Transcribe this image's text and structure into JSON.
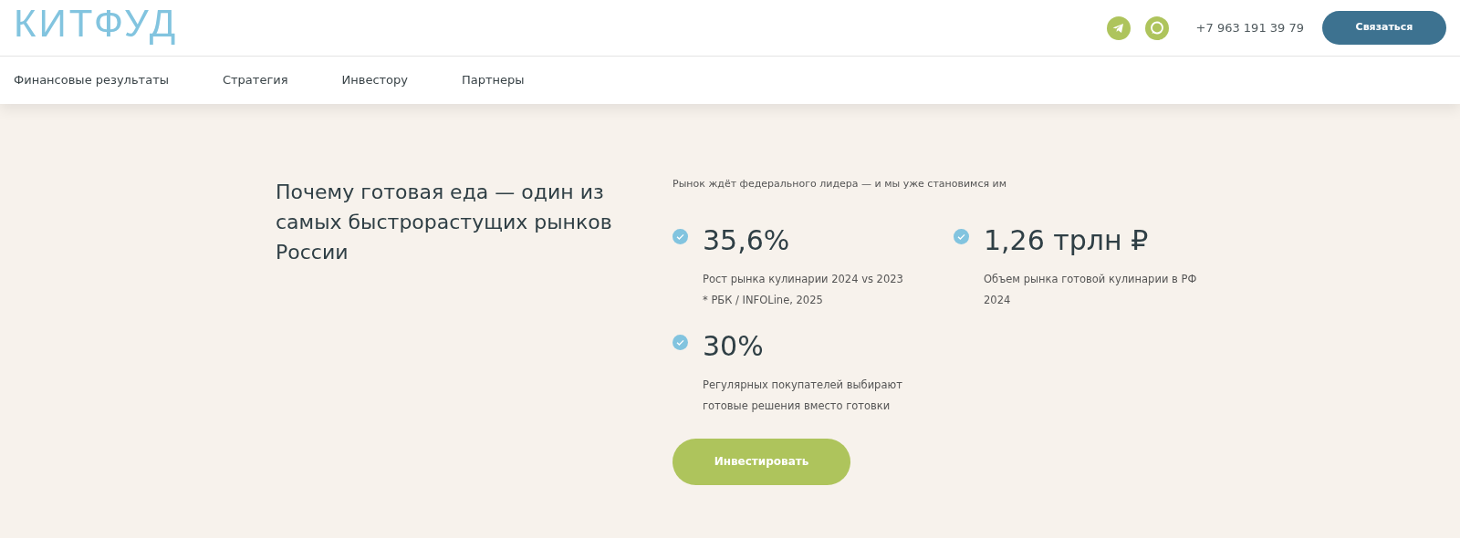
{
  "header": {
    "brand": "КИТФУД",
    "phone": "+7 963 191 39 79",
    "contact_button": "Связаться"
  },
  "nav": [
    "Финансовые результаты",
    "Стратегия",
    "Инвестору",
    "Партнеры"
  ],
  "hero": {
    "heading": "Почему готовая еда — один из самых быстрорастущих рынков России",
    "subtitle": "Рынок ждёт федерального лидера — и мы уже становимся им",
    "stats": [
      {
        "value": "35,6%",
        "captions": [
          "Рост рынка кулинарии 2024 vs 2023",
          "* РБК / INFOLine, 2025"
        ]
      },
      {
        "value": "1,26 трлн ₽",
        "captions": [
          "Объем рынка готовой кулинарии в РФ 2024"
        ]
      },
      {
        "value": "30%",
        "captions": [
          "Регулярных покупателей выбирают готовые решения вместо готовки"
        ]
      }
    ],
    "invest_button": "Инвестировать"
  }
}
